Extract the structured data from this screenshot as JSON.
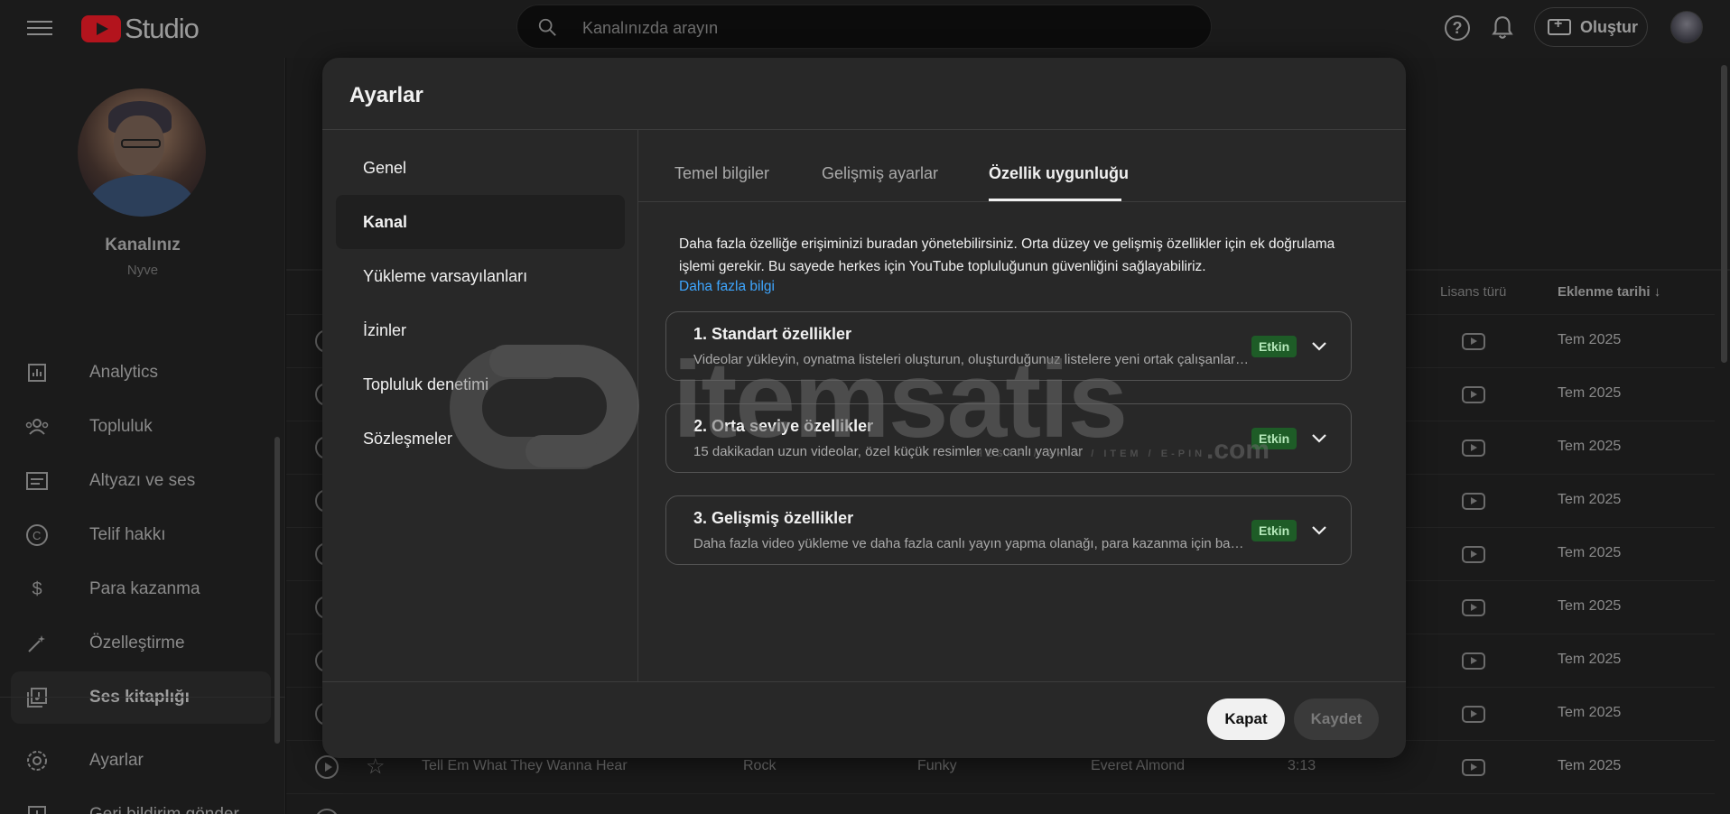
{
  "app": {
    "logo_text": "Studio",
    "search_placeholder": "Kanalınızda arayın",
    "create_label": "Oluştur"
  },
  "sidebar": {
    "channel_title": "Kanalınız",
    "channel_handle": "Nyve",
    "items": [
      {
        "label": "Analytics",
        "icon": "analytics-icon"
      },
      {
        "label": "Topluluk",
        "icon": "community-icon"
      },
      {
        "label": "Altyazı ve ses",
        "icon": "subtitles-icon"
      },
      {
        "label": "Telif hakkı",
        "icon": "copyright-icon"
      },
      {
        "label": "Para kazanma",
        "icon": "dollar-icon"
      },
      {
        "label": "Özelleştirme",
        "icon": "magic-wand-icon"
      },
      {
        "label": "Ses kitaplığı",
        "icon": "audio-library-icon"
      }
    ],
    "bottom_items": [
      {
        "label": "Ayarlar",
        "icon": "gear-icon"
      },
      {
        "label": "Geri bildirim gönder",
        "icon": "feedback-icon"
      }
    ]
  },
  "table": {
    "headers": {
      "license": "Lisans türü",
      "added": "Eklenme tarihi"
    },
    "dates": [
      "Tem 2025",
      "Tem 2025",
      "Tem 2025",
      "Tem 2025",
      "Tem 2025",
      "Tem 2025",
      "Tem 2025",
      "Tem 2025",
      "Tem 2025"
    ],
    "visible_row": {
      "title": "Tell Em What They Wanna Hear",
      "genre": "Rock",
      "mood": "Funky",
      "artist": "Everet Almond",
      "duration": "3:13"
    }
  },
  "dialog": {
    "title": "Ayarlar",
    "nav": [
      "Genel",
      "Kanal",
      "Yükleme varsayılanları",
      "İzinler",
      "Topluluk denetimi",
      "Sözleşmeler"
    ],
    "nav_active": "Kanal",
    "tabs": [
      "Temel bilgiler",
      "Gelişmiş ayarlar",
      "Özellik uygunluğu"
    ],
    "active_tab": "Özellik uygunluğu",
    "description": "Daha fazla özelliğe erişiminizi buradan yönetebilirsiniz. Orta düzey ve gelişmiş özellikler için ek doğrulama işlemi gerekir. Bu sayede herkes için YouTube topluluğunun güvenliğini sağlayabiliriz.",
    "learn_more": "Daha fazla bilgi",
    "features": [
      {
        "title": "1. Standart özellikler",
        "desc": "Videolar yükleyin, oynatma listeleri oluşturun, oluşturduğunuz listelere yeni ortak çalışanlar ekleyin",
        "badge": "Etkin"
      },
      {
        "title": "2. Orta seviye özellikler",
        "desc": "15 dakikadan uzun videolar, özel küçük resimler ve canlı yayınlar",
        "badge": "Etkin"
      },
      {
        "title": "3. Gelişmiş özellikler",
        "desc": "Daha fazla video yükleme ve daha fazla canlı yayın yapma olanağı, para kazanma için başvuru",
        "badge": "Etkin"
      }
    ],
    "close_label": "Kapat",
    "save_label": "Kaydet"
  },
  "watermark": {
    "text": "itemsatis",
    "sub": "HESAP / SKIN / ITEM / E-PIN",
    "suffix": ".com"
  },
  "colors": {
    "accent_link": "#3ea6ff",
    "badge_bg": "#1e5c27",
    "badge_text": "#b5e8ba",
    "logo_red": "#b3141d"
  }
}
